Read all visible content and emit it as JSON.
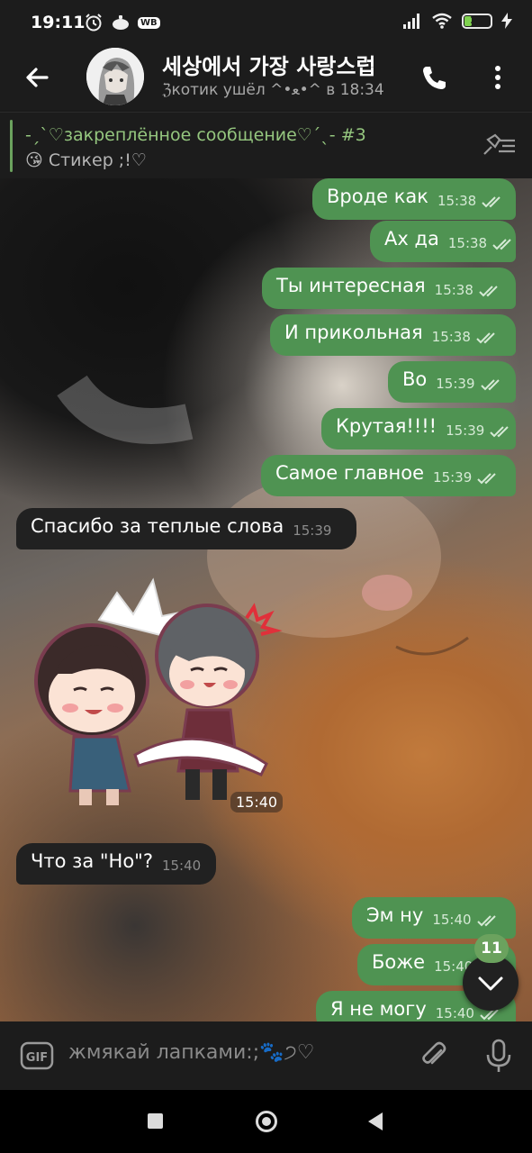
{
  "status_bar": {
    "time": "19:11",
    "wb_label": "WB",
    "battery": "27",
    "battery_fraction": 0.27
  },
  "header": {
    "title": "세상에서 가장 사랑스럽",
    "subtitle": "ℨкотик ушёл ^•ﻌ•^ в 18:34"
  },
  "pinned": {
    "title": "-ˏˋ♡закреплённое сообщение♡ˊˎ- #3",
    "text": "😘 Стикер ;!♡"
  },
  "messages": [
    {
      "dir": "out",
      "text": "Вроде как",
      "time": "15:38"
    },
    {
      "dir": "out",
      "text": "Ах да",
      "time": "15:38"
    },
    {
      "dir": "out",
      "text": "Ты интересная",
      "time": "15:38"
    },
    {
      "dir": "out",
      "text": "И прикольная",
      "time": "15:38"
    },
    {
      "dir": "out",
      "text": "Во",
      "time": "15:39"
    },
    {
      "dir": "out",
      "text": "Крутая!!!!",
      "time": "15:39"
    },
    {
      "dir": "out",
      "text": "Самое главное",
      "time": "15:39"
    },
    {
      "dir": "in",
      "text": "Спасибо за теплые слова",
      "time": "15:39"
    },
    {
      "dir": "in",
      "text": "Что за \"Но\"?",
      "time": "15:40"
    },
    {
      "dir": "out",
      "text": "Эм ну",
      "time": "15:40"
    },
    {
      "dir": "out",
      "text": "Боже",
      "time": "15:40"
    },
    {
      "dir": "out",
      "text": "Я не могу",
      "time": "15:40"
    }
  ],
  "sticker": {
    "time": "15:40"
  },
  "unread_count": "11",
  "input": {
    "placeholder": "жмякай лапками:;🐾੭♡"
  },
  "colors": {
    "outgoing_bubble": "#4f9352",
    "incoming_bubble": "#212121",
    "accent": "#6ba25e"
  }
}
